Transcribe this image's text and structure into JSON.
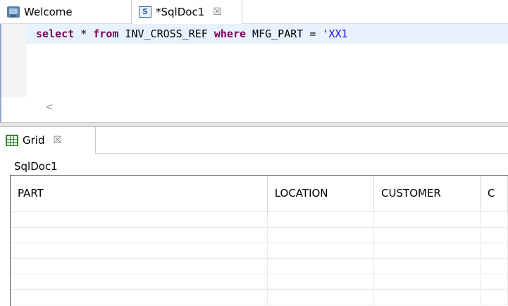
{
  "editor": {
    "tabs": [
      {
        "label": "Welcome",
        "icon": "welcome-icon"
      },
      {
        "label": "*SqlDoc1",
        "icon": "sql-file-icon",
        "close": "☒"
      }
    ],
    "sql": {
      "k_select": "select",
      "star": " * ",
      "k_from": "from",
      "table": " INV_CROSS_REF ",
      "k_where": "where",
      "cond": " MFG_PART = ",
      "str": "'XX1"
    },
    "scroll_left": "<"
  },
  "grid_panel": {
    "tab_label": "Grid",
    "tab_close": "☒",
    "result_tab": "SqlDoc1",
    "columns": [
      "PART",
      "LOCATION",
      "CUSTOMER",
      "C"
    ],
    "rows": 6
  }
}
